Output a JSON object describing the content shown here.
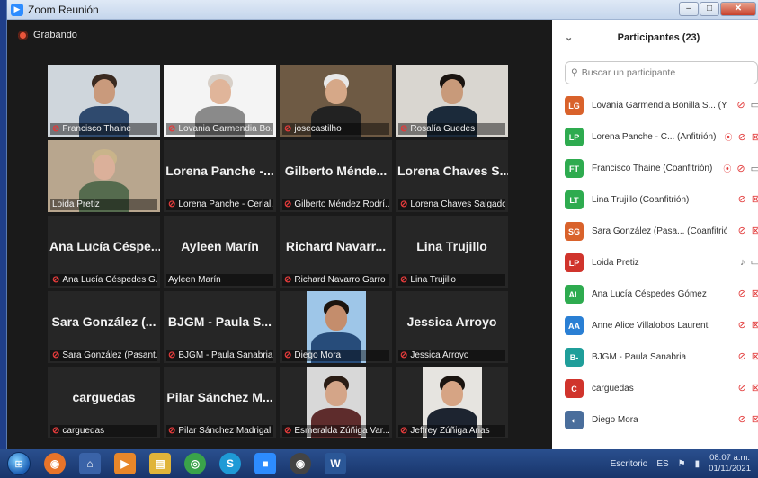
{
  "window": {
    "title": "Zoom Reunión",
    "recording_label": "Grabando"
  },
  "tiles": [
    {
      "name": "Francisco Thaine",
      "big": "",
      "muted": true,
      "video": "man-glasses",
      "active": false
    },
    {
      "name": "Lovania Garmendia Bo...",
      "big": "",
      "muted": true,
      "video": "woman-logo",
      "active": false
    },
    {
      "name": "josecastilho",
      "big": "",
      "muted": true,
      "video": "man-shelf",
      "active": false
    },
    {
      "name": "Rosalía Guedes",
      "big": "",
      "muted": true,
      "video": "woman-curly",
      "active": false
    },
    {
      "name": "Loida Pretiz",
      "big": "",
      "muted": false,
      "video": "woman-blond",
      "active": true
    },
    {
      "name": "Lorena Panche - Cerlal...",
      "big": "Lorena Panche -...",
      "muted": true,
      "video": "",
      "active": false
    },
    {
      "name": "Gilberto Méndez Rodrí...",
      "big": "Gilberto Ménde...",
      "muted": true,
      "video": "",
      "active": false
    },
    {
      "name": "Lorena Chaves Salgado",
      "big": "Lorena Chaves S...",
      "muted": true,
      "video": "",
      "active": false
    },
    {
      "name": "Ana Lucía Céspedes G...",
      "big": "Ana Lucía Céspe...",
      "muted": true,
      "video": "",
      "active": false
    },
    {
      "name": "Ayleen Marín",
      "big": "Ayleen Marín",
      "muted": false,
      "video": "",
      "active": false
    },
    {
      "name": "Richard Navarro Garro",
      "big": "Richard Navarr...",
      "muted": true,
      "video": "",
      "active": false
    },
    {
      "name": "Lina Trujillo",
      "big": "Lina Trujillo",
      "muted": true,
      "video": "",
      "active": false
    },
    {
      "name": "Sara González (Pasant...",
      "big": "Sara González (...",
      "muted": true,
      "video": "",
      "active": false
    },
    {
      "name": "BJGM - Paula Sanabria",
      "big": "BJGM - Paula S...",
      "muted": true,
      "video": "",
      "active": false
    },
    {
      "name": "Diego Mora",
      "big": "",
      "muted": true,
      "video": "man-blue",
      "active": false
    },
    {
      "name": "Jessica Arroyo",
      "big": "Jessica Arroyo",
      "muted": true,
      "video": "",
      "active": false
    },
    {
      "name": "carguedas",
      "big": "carguedas",
      "muted": true,
      "video": "",
      "active": false
    },
    {
      "name": "Pilar Sánchez Madrigal",
      "big": "Pilar Sánchez M...",
      "muted": true,
      "video": "",
      "active": false
    },
    {
      "name": "Esmeralda Zúñiga Var...",
      "big": "",
      "muted": true,
      "video": "woman-dark",
      "active": false
    },
    {
      "name": "Jeffrey Zúñiga Arias",
      "big": "",
      "muted": true,
      "video": "man-suit",
      "active": false
    }
  ],
  "panel": {
    "title": "Participantes (23)",
    "search_placeholder": "Buscar un participante",
    "participants": [
      {
        "initials": "LG",
        "color": "#d9622b",
        "name": "Lovania Garmendia Bonilla S... (Yo)",
        "rec": false,
        "mic": "muted",
        "cam": "on"
      },
      {
        "initials": "LP",
        "color": "#2eab4f",
        "name": "Lorena Panche - C... (Anfitrión)",
        "rec": true,
        "mic": "muted",
        "cam": "off"
      },
      {
        "initials": "FT",
        "color": "#2eab4f",
        "name": "Francisco Thaine (Coanfitrión)",
        "rec": true,
        "mic": "muted",
        "cam": "on"
      },
      {
        "initials": "LT",
        "color": "#2eab4f",
        "name": "Lina Trujillo (Coanfitrión)",
        "rec": false,
        "mic": "muted",
        "cam": "off"
      },
      {
        "initials": "SG",
        "color": "#d9622b",
        "name": "Sara González (Pasa... (Coanfitrión)",
        "rec": false,
        "mic": "muted",
        "cam": "off"
      },
      {
        "initials": "LP",
        "color": "#d0342c",
        "name": "Loida Pretiz",
        "rec": false,
        "mic": "on",
        "cam": "on"
      },
      {
        "initials": "AL",
        "color": "#2eab4f",
        "name": "Ana Lucía Céspedes Gómez",
        "rec": false,
        "mic": "muted",
        "cam": "off"
      },
      {
        "initials": "AA",
        "color": "#2a7fd4",
        "name": "Anne Alice Villalobos Laurent",
        "rec": false,
        "mic": "muted",
        "cam": "off"
      },
      {
        "initials": "B-",
        "color": "#1f9e9a",
        "name": "BJGM - Paula Sanabria",
        "rec": false,
        "mic": "muted",
        "cam": "off"
      },
      {
        "initials": "C",
        "color": "#d0342c",
        "name": "carguedas",
        "rec": false,
        "mic": "muted",
        "cam": "off"
      },
      {
        "initials": "",
        "color": "#4a6e9c",
        "name": "Diego Mora",
        "rec": false,
        "mic": "muted",
        "cam": "off"
      }
    ]
  },
  "taskbar": {
    "desktop_label": "Escritorio",
    "lang": "ES",
    "time": "08:07 a.m.",
    "date": "01/11/2021"
  }
}
